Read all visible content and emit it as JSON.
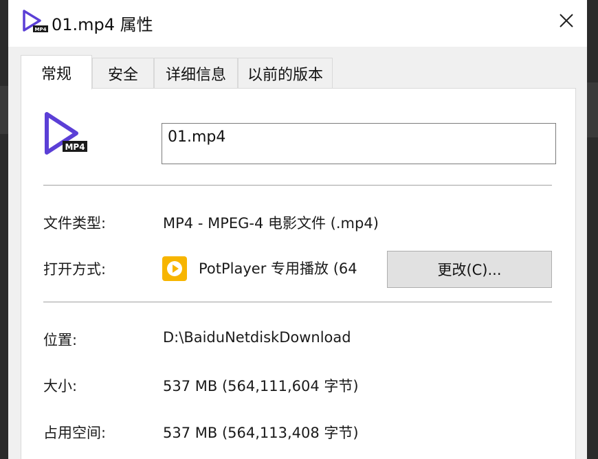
{
  "window": {
    "title": "01.mp4 属性",
    "close_glyph": "✕",
    "icon": "mp4-file-icon"
  },
  "tabs": [
    {
      "label": "常规",
      "active": true
    },
    {
      "label": "安全",
      "active": false
    },
    {
      "label": "详细信息",
      "active": false
    },
    {
      "label": "以前的版本",
      "active": false
    }
  ],
  "general": {
    "file_icon_badge": "MP4",
    "file_name": "01.mp4",
    "file_type_label": "文件类型:",
    "file_type_value": "MP4 - MPEG-4 电影文件 (.mp4)",
    "open_with_label": "打开方式:",
    "open_with_app": "PotPlayer 专用播放 (64",
    "open_with_icon": "potplayer-icon",
    "change_button": "更改(C)...",
    "location_label": "位置:",
    "location_value": "D:\\BaiduNetdiskDownload",
    "size_label": "大小:",
    "size_value": "537 MB (564,111,604 字节)",
    "size_on_disk_label": "占用空间:",
    "size_on_disk_value": "537 MB (564,113,408 字节)"
  },
  "colors": {
    "accent_purple": "#5b3fd6",
    "potplayer_yellow": "#f7b500"
  }
}
